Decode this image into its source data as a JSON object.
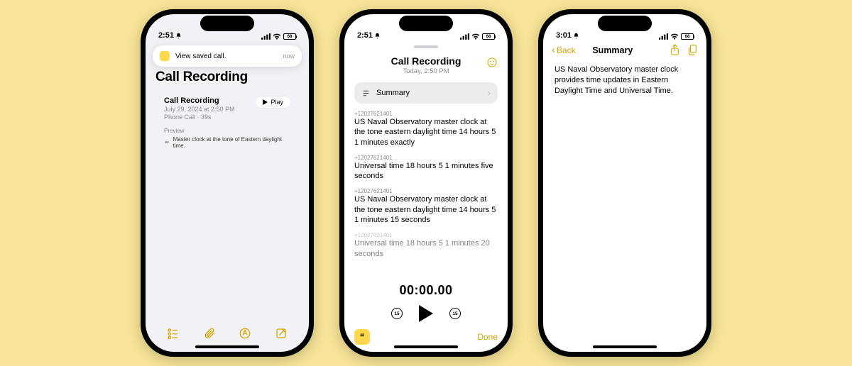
{
  "status": {
    "time1": "2:51",
    "time2": "2:51",
    "time3": "3:01",
    "battery": "68"
  },
  "phone1": {
    "toast": {
      "text": "View saved call.",
      "when": "now"
    },
    "title": "Call Recording",
    "card": {
      "title": "Call Recording",
      "date": "July 29, 2024 at 2:50 PM",
      "meta": "Phone Call · 39s",
      "play": "Play",
      "previewLabel": "Preview",
      "previewText": "Master clock at the tone of Eastern daylight time."
    }
  },
  "phone2": {
    "title": "Call Recording",
    "sub": "Today, 2:50 PM",
    "summaryLabel": "Summary",
    "messages": [
      {
        "num": "+12027621401",
        "txt": "US Naval Observatory master clock at the tone eastern daylight time 14 hours 5 1 minutes exactly"
      },
      {
        "num": "+12027621401",
        "txt": "Universal time 18 hours 5 1 minutes five seconds"
      },
      {
        "num": "+12027621401",
        "txt": "US Naval Observatory master clock at the tone eastern daylight time 14 hours 5 1 minutes 15 seconds"
      },
      {
        "num": "+12027621401",
        "txt": "Universal time 18 hours 5 1 minutes 20 seconds"
      }
    ],
    "time": "00:00.00",
    "skip": "15",
    "done": "Done"
  },
  "phone3": {
    "back": "Back",
    "title": "Summary",
    "body": "US Naval Observatory master clock provides time updates in Eastern Daylight Time and Universal Time."
  }
}
